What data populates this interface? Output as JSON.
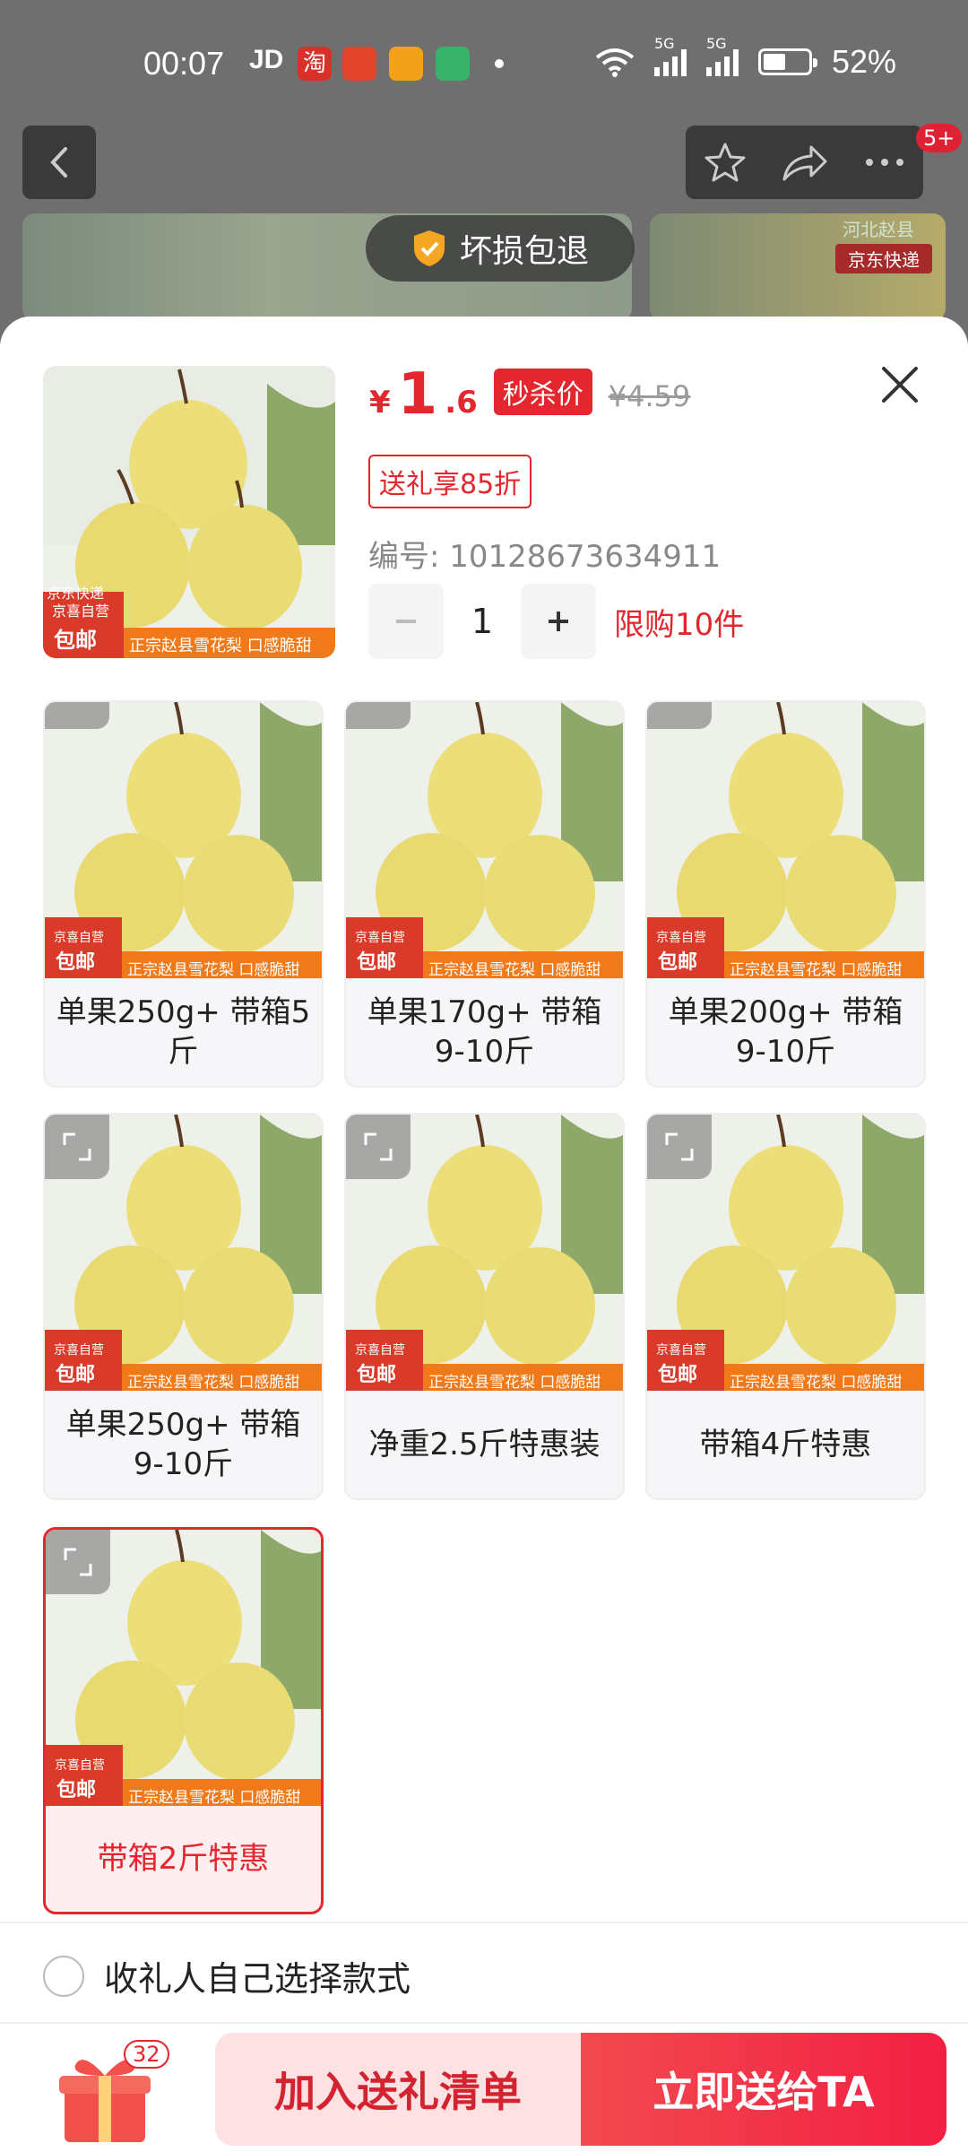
{
  "status_bar": {
    "time": "00:07",
    "jd": "JD",
    "taobao": "淘",
    "signal_5g_1": "5G",
    "signal_5g_2": "5G",
    "battery": "52%"
  },
  "background": {
    "pill_text": "坏损包退",
    "region_tag": "河北赵县",
    "express_tag": "京东快递",
    "badge": "5+"
  },
  "product": {
    "currency": "¥",
    "price_int": "1",
    "price_dec": ".6",
    "flash_label": "秒杀价",
    "orig_price": "¥4.59",
    "gift_tag": "送礼享85折",
    "sku": "编号: 10128673634911",
    "qty": "1",
    "limit": "限购10件",
    "img_caption": "正宗赵县雪花梨 口感脆甜",
    "img_badge1": "京东快递",
    "img_badge2": "京喜自营",
    "img_badge3": "包邮"
  },
  "options": [
    {
      "label": "单果250g+ 带箱5斤"
    },
    {
      "label": "单果170g+ 带箱9-10斤"
    },
    {
      "label": "单果200g+ 带箱9-10斤"
    },
    {
      "label": "单果250g+ 带箱9-10斤"
    },
    {
      "label": "净重2.5斤特惠装"
    },
    {
      "label": "带箱4斤特惠"
    },
    {
      "label": "带箱2斤特惠",
      "selected": true
    }
  ],
  "footer": {
    "self_choose": "收礼人自己选择款式",
    "gift_count": "32",
    "add_label": "加入送礼清单",
    "send_label": "立即送给TA"
  },
  "colors": {
    "accent": "#e4262e",
    "send_button": "#f21f43",
    "add_button_bg": "#fde1e3"
  }
}
